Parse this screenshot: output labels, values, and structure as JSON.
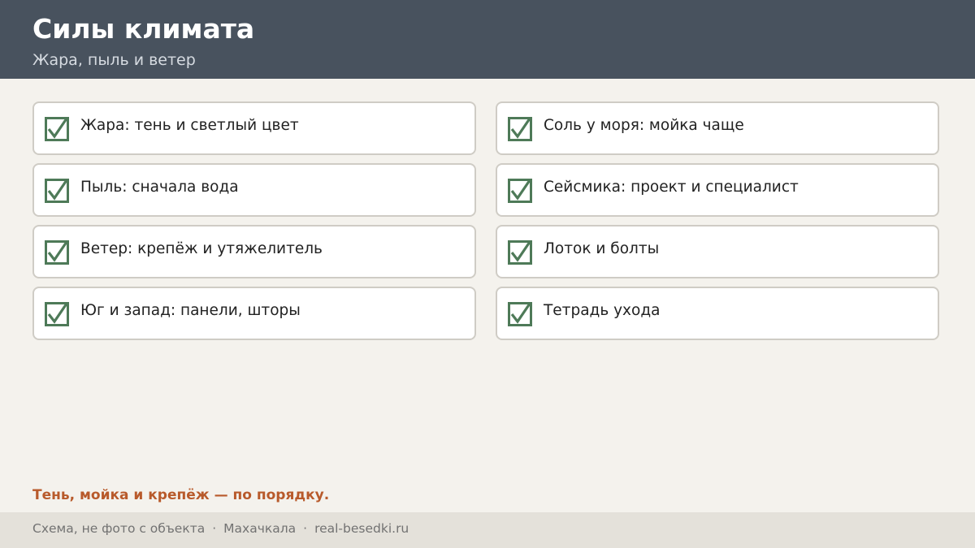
{
  "header": {
    "title": "Силы климата",
    "subtitle": "Жара, пыль и ветер"
  },
  "checklist": {
    "left": [
      "Жара: тень и светлый цвет",
      "Пыль: сначала вода",
      "Ветер: крепёж и утяжелитель",
      "Юг и запад: панели, шторы"
    ],
    "right": [
      "Соль у моря: мойка чаще",
      "Сейсмика: проект и специалист",
      "Лоток и болты",
      "Тетрадь ухода"
    ],
    "check_icon": "checkbox-checked-icon",
    "check_color": "#4e7a58"
  },
  "tagline": "Тень, мойка и крепёж — по порядку.",
  "footer": {
    "note": "Схема, не фото с объекта",
    "city": "Махачкала",
    "site": "real-besedki.ru",
    "separator": "·"
  },
  "colors": {
    "header_bg": "#48525e",
    "page_bg": "#f4f2ed",
    "accent": "#b85a2b",
    "footer_bg": "#e4e1da"
  }
}
